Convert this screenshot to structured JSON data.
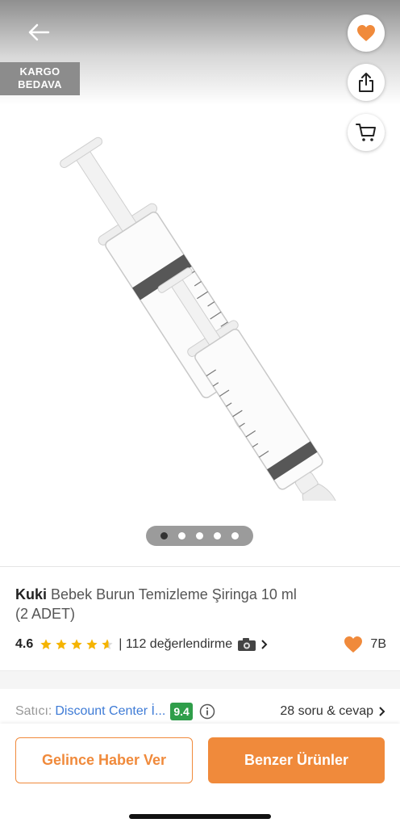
{
  "header": {
    "back_icon": "arrow-left-icon",
    "badge_line1": "KARGO",
    "badge_line2": "BEDAVA",
    "favorite_icon": "heart-icon",
    "share_icon": "share-icon",
    "cart_icon": "cart-icon",
    "accent_color": "#f08a3b"
  },
  "gallery": {
    "image": "nasal-aspirator-syringes",
    "pages": 5,
    "active_page": 1
  },
  "product": {
    "brand": "Kuki",
    "name": "Bebek Burun Temizleme Şiringa 10 ml",
    "name_line2": "(2 ADET)",
    "rating": "4.6",
    "stars": 4.6,
    "reviews": "| 112 değerlendirme",
    "camera_icon": "camera-icon",
    "favorites_count": "7B"
  },
  "seller": {
    "label": "Satıcı:",
    "name": "Discount Center İ...",
    "score": "9.4",
    "score_color": "#2f9e4a",
    "qa": "28 soru & cevap"
  },
  "actions": {
    "notify_label": "Gelince Haber Ver",
    "similar_label": "Benzer Ürünler"
  }
}
